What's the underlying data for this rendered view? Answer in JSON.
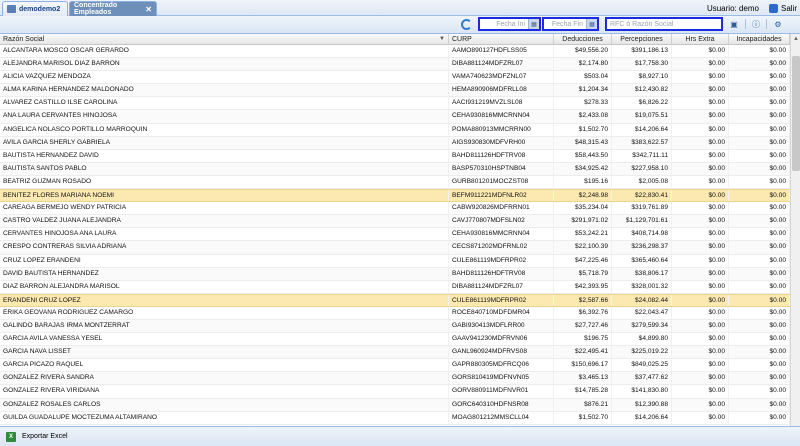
{
  "tabs": [
    {
      "label": "demodemo2",
      "active": false
    },
    {
      "label": "Concentrado Empleados",
      "active": true
    }
  ],
  "user": {
    "label": "Usuario: demo",
    "exit_label": "Salir"
  },
  "toolbar": {
    "fecha_ini_placeholder": "Fecha Ini",
    "fecha_fin_placeholder": "Fecha Fin",
    "search_placeholder": "RFC ó Razón Social"
  },
  "columns": [
    "Razón Social",
    "CURP",
    "Deducciones",
    "Percepciones",
    "Hrs Extra",
    "Incapacidades"
  ],
  "rows": [
    [
      "ALCANTARA MOSCO OSCAR GERARDO",
      "AAMO890127HDFLSS05",
      "$49,556.20",
      "$391,186.13",
      "$0.00",
      "$0.00"
    ],
    [
      "ALEJANDRA MARISOL DIAZ BARRON",
      "DIBA881124MDFZRL07",
      "$2,174.80",
      "$17,758.30",
      "$0.00",
      "$0.00"
    ],
    [
      "ALICIA VAZQUEZ MENDOZA",
      "VAMA740623MDFZNL07",
      "$503.04",
      "$8,927.10",
      "$0.00",
      "$0.00"
    ],
    [
      "ALMA KARINA HERNANDEZ MALDONADO",
      "HEMA890906MDFRLL08",
      "$1,204.34",
      "$12,430.82",
      "$0.00",
      "$0.00"
    ],
    [
      "ALVAREZ CASTILLO ILSE CAROLINA",
      "AACI931219MVZLSL08",
      "$278.33",
      "$6,826.22",
      "$0.00",
      "$0.00"
    ],
    [
      "ANA LAURA CERVANTES HINOJOSA",
      "CEHA930816MMCRNN04",
      "$2,433.08",
      "$19,075.51",
      "$0.00",
      "$0.00"
    ],
    [
      "ANGELICA NOLASCO PORTILLO MARROQUIN",
      "POMA880913MMCRRN00",
      "$1,502.70",
      "$14,206.64",
      "$0.00",
      "$0.00"
    ],
    [
      "AVILA GARCIA SHERLY GABRIELA",
      "AIGS930830MDFVRH00",
      "$48,315.43",
      "$383,622.57",
      "$0.00",
      "$0.00"
    ],
    [
      "BAUTISTA HERNANDEZ DAVID",
      "BAHD811126HDFTRV08",
      "$58,443.50",
      "$342,711.11",
      "$0.00",
      "$0.00"
    ],
    [
      "BAUTISTA SANTOS PABLO",
      "BASP570310HSPTNB04",
      "$34,925.42",
      "$227,958.10",
      "$0.00",
      "$0.00"
    ],
    [
      "BEATRIZ GUZMAN ROSADO",
      "GURB801201MOCZST08",
      "$195.16",
      "$2,005.08",
      "$0.00",
      "$0.00"
    ],
    [
      "BENITEZ FLORES MARIANA NOEMI",
      "BEFM911221MDFNLR02",
      "$2,248.98",
      "$22,830.41",
      "$0.00",
      "$0.00"
    ],
    [
      "CAREAGA BERMEJO WENDY PATRICIA",
      "CABW920826MDFRRN01",
      "$35,234.04",
      "$319,761.89",
      "$0.00",
      "$0.00"
    ],
    [
      "CASTRO VALDEZ JUANA ALEJANDRA",
      "CAVJ770807MDFSLN02",
      "$291,971.02",
      "$1,129,701.61",
      "$0.00",
      "$0.00"
    ],
    [
      "CERVANTES HINOJOSA ANA LAURA",
      "CEHA930816MMCRNN04",
      "$53,242.21",
      "$408,714.98",
      "$0.00",
      "$0.00"
    ],
    [
      "CRESPO CONTRERAS SILVIA ADRIANA",
      "CECS871202MDFRNL02",
      "$22,100.39",
      "$236,298.37",
      "$0.00",
      "$0.00"
    ],
    [
      "CRUZ LOPEZ ERANDENI",
      "CULE861119MDFRPR02",
      "$47,225.46",
      "$365,460.64",
      "$0.00",
      "$0.00"
    ],
    [
      "DAVID BAUTISTA HERNANDEZ",
      "BAHD811126HDFTRV08",
      "$5,718.79",
      "$38,806.17",
      "$0.00",
      "$0.00"
    ],
    [
      "DIAZ BARRON ALEJANDRA MARISOL",
      "DIBA881124MDFZRL07",
      "$42,393.95",
      "$328,001.32",
      "$0.00",
      "$0.00"
    ],
    [
      "ERANDENI CRUZ LOPEZ",
      "CULE861119MDFRPR02",
      "$2,587.66",
      "$24,082.44",
      "$0.00",
      "$0.00"
    ],
    [
      "ERIKA GEOVANA RODRIGUEZ CAMARGO",
      "ROCE840710MDFDMR04",
      "$6,392.76",
      "$22,043.47",
      "$0.00",
      "$0.00"
    ],
    [
      "GALINDO BARAJAS IRMA MONTZERRAT",
      "GABI930413MDFLRR00",
      "$27,727.46",
      "$279,599.34",
      "$0.00",
      "$0.00"
    ],
    [
      "GARCIA AVILA VANESSA YESEL",
      "GAAV941230MDFRVN06",
      "$196.75",
      "$4,899.80",
      "$0.00",
      "$0.00"
    ],
    [
      "GARCIA NAVA LISSET",
      "GANL960924MDFRVS08",
      "$22,495.41",
      "$225,019.22",
      "$0.00",
      "$0.00"
    ],
    [
      "GARCIA PICAZO RAQUEL",
      "GAPR880305MDFRCQ06",
      "$150,696.17",
      "$849,025.25",
      "$0.00",
      "$0.00"
    ],
    [
      "GONZALEZ RIVERA SANDRA",
      "GORS810419MDFNVN05",
      "$3,465.13",
      "$37,477.62",
      "$0.00",
      "$0.00"
    ],
    [
      "GONZALEZ RIVERA VIRIDIANA",
      "GORV880911MDFNVR01",
      "$14,785.28",
      "$141,830.80",
      "$0.00",
      "$0.00"
    ],
    [
      "GONZALEZ ROSALES CARLOS",
      "GORC640310HDFNSR08",
      "$876.21",
      "$12,390.88",
      "$0.00",
      "$0.00"
    ],
    [
      "GUILDA GUADALUPE MOCTEZUMA ALTAMIRANO",
      "MOAG801212MMSCLL04",
      "$1,502.70",
      "$14,206.64",
      "$0.00",
      "$0.00"
    ]
  ],
  "selected_rows": [
    11,
    19
  ],
  "footer": {
    "export_label": "Exportar Excel"
  }
}
